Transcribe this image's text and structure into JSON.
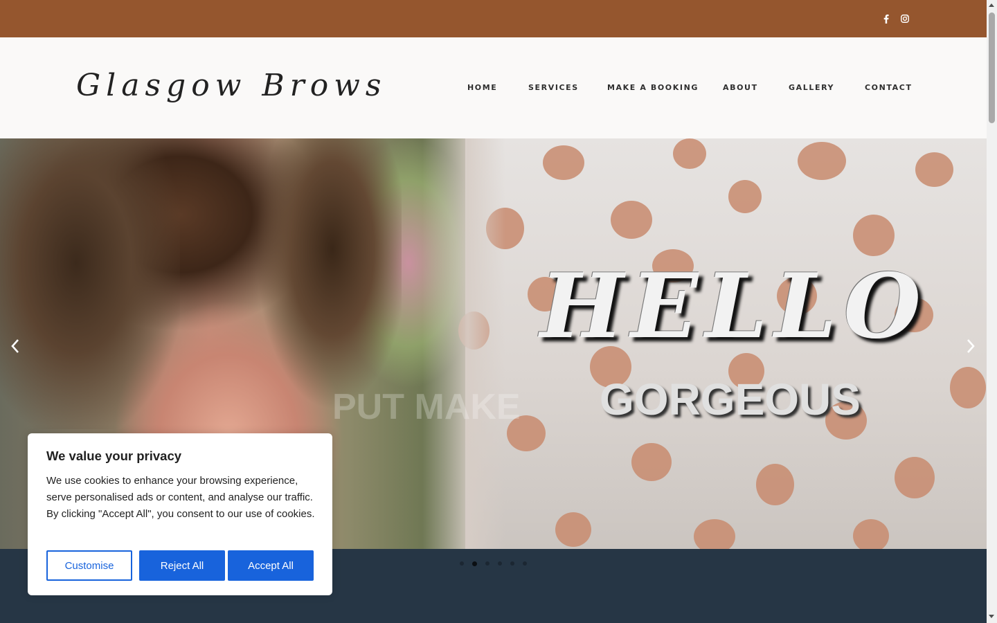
{
  "site": {
    "logo_text": "Glasgow Brows"
  },
  "topbar": {
    "background": "#95562e",
    "social_icons": [
      "facebook-icon",
      "instagram-icon"
    ]
  },
  "nav": {
    "items": [
      "HOME",
      "SERVICES",
      "MAKE A BOOKING",
      "ABOUT",
      "GALLERY",
      "CONTACT"
    ]
  },
  "slider": {
    "headline": "HELLO",
    "subheadline": "GORGEOUS",
    "ghost_text": "PUT MAKE",
    "slide_count": 6,
    "active_slide": 2,
    "prev_icon": "chevron-left-icon",
    "next_icon": "chevron-right-icon"
  },
  "cookie_banner": {
    "title": "We value your privacy",
    "body": "We use cookies to enhance your browsing experience, serve personalised ads or content, and analyse our traffic. By clicking \"Accept All\", you consent to our use of cookies.",
    "customise_label": "Customise",
    "reject_label": "Reject All",
    "accept_label": "Accept All",
    "accent_color": "#1863dc"
  },
  "footer_band": {
    "background": "#263645"
  }
}
